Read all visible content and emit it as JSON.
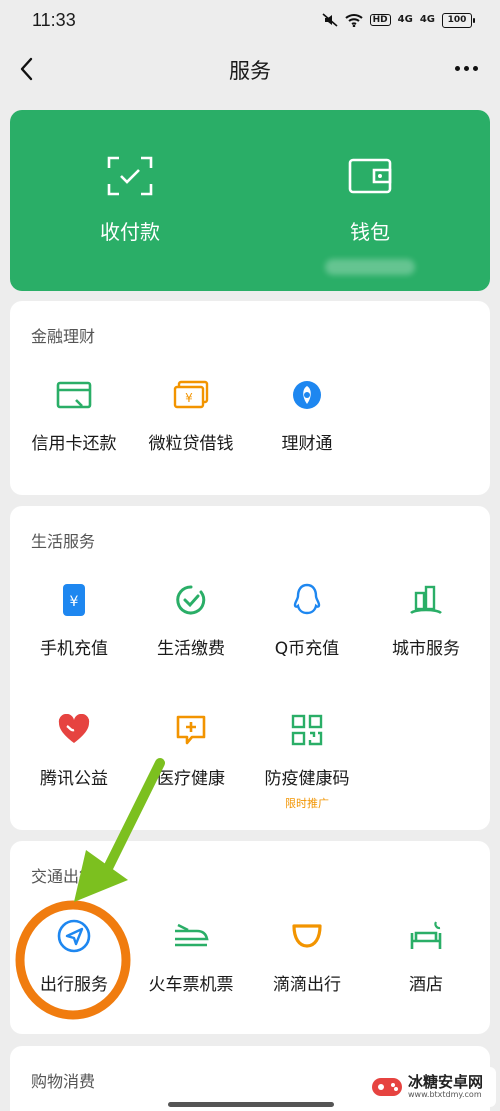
{
  "status_bar": {
    "time": "11:33",
    "signal1": "4G",
    "signal2": "4G",
    "hd": "HD",
    "battery": "100"
  },
  "nav": {
    "title": "服务"
  },
  "hero": {
    "items": [
      {
        "label": "收付款",
        "icon": "scan-pay-icon"
      },
      {
        "label": "钱包",
        "icon": "wallet-icon"
      }
    ]
  },
  "finance": {
    "title": "金融理财",
    "items": [
      {
        "label": "信用卡还款",
        "icon": "credit-card-icon",
        "color": "#2aae67"
      },
      {
        "label": "微粒贷借钱",
        "icon": "cash-icon",
        "color": "#f29400"
      },
      {
        "label": "理财通",
        "icon": "wealth-icon",
        "color": "#1e87f0"
      }
    ]
  },
  "life": {
    "title": "生活服务",
    "items": [
      {
        "label": "手机充值",
        "icon": "phone-recharge-icon",
        "color": "#1e87f0"
      },
      {
        "label": "生活缴费",
        "icon": "utility-bill-icon",
        "color": "#2aae67"
      },
      {
        "label": "Q币充值",
        "icon": "qq-coin-icon",
        "color": "#1e87f0"
      },
      {
        "label": "城市服务",
        "icon": "city-service-icon",
        "color": "#2aae67"
      },
      {
        "label": "腾讯公益",
        "icon": "charity-icon",
        "color": "#e64340"
      },
      {
        "label": "医疗健康",
        "icon": "medical-icon",
        "color": "#f29400"
      },
      {
        "label": "防疫健康码",
        "icon": "health-code-icon",
        "color": "#2aae67",
        "badge": "限时推广"
      }
    ]
  },
  "transport": {
    "title": "交通出行",
    "items": [
      {
        "label": "出行服务",
        "icon": "navigation-icon",
        "color": "#1e87f0"
      },
      {
        "label": "火车票机票",
        "icon": "train-icon",
        "color": "#2aae67"
      },
      {
        "label": "滴滴出行",
        "icon": "didi-icon",
        "color": "#f29400"
      },
      {
        "label": "酒店",
        "icon": "hotel-icon",
        "color": "#2aae67"
      }
    ]
  },
  "shopping": {
    "title": "购物消费"
  },
  "watermark": {
    "name": "冰糖安卓网",
    "url": "www.btxtdmy.com"
  },
  "annotation": {
    "arrow_color": "#7cc01f",
    "circle_color": "#f07c0f"
  }
}
